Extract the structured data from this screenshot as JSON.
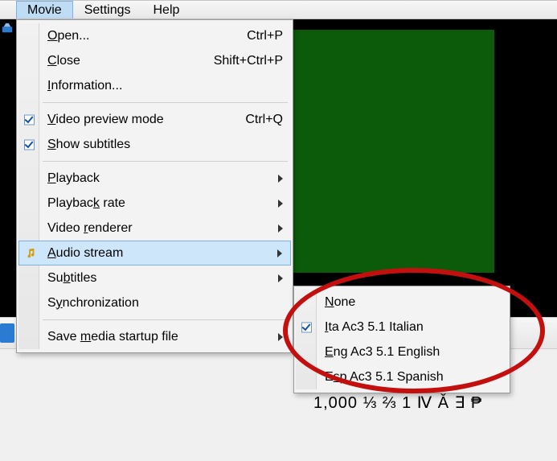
{
  "menubar": {
    "items": [
      {
        "label": "Movie",
        "active": true
      },
      {
        "label": "Settings",
        "active": false
      },
      {
        "label": "Help",
        "active": false
      }
    ]
  },
  "menu": {
    "open": {
      "label_pre": "",
      "u": "O",
      "label_post": "pen...",
      "shortcut": "Ctrl+P"
    },
    "close": {
      "label_pre": "",
      "u": "C",
      "label_post": "lose",
      "shortcut": "Shift+Ctrl+P"
    },
    "info": {
      "label_pre": "",
      "u": "I",
      "label_post": "nformation...",
      "shortcut": ""
    },
    "vpreview": {
      "label_pre": "",
      "u": "V",
      "label_post": "ideo preview mode",
      "shortcut": "Ctrl+Q",
      "checked": true
    },
    "showsub": {
      "label_pre": "",
      "u": "S",
      "label_post": "how subtitles",
      "shortcut": "",
      "checked": true
    },
    "playback": {
      "label_pre": "",
      "u": "P",
      "label_post": "layback"
    },
    "playrate": {
      "label_pre": "Playbac",
      "u": "k",
      "label_post": " rate"
    },
    "vrender": {
      "label_pre": "Video ",
      "u": "r",
      "label_post": "enderer"
    },
    "astream": {
      "label_pre": "",
      "u": "A",
      "label_post": "udio stream"
    },
    "subtitles": {
      "label_pre": "Su",
      "u": "b",
      "label_post": "titles"
    },
    "sync": {
      "label_pre": "S",
      "u": "y",
      "label_post": "nchronization"
    },
    "savestart": {
      "label_pre": "Save ",
      "u": "m",
      "label_post": "edia startup file"
    }
  },
  "submenu": {
    "none": {
      "label_pre": "",
      "u": "N",
      "label_post": "one",
      "checked": false
    },
    "ita": {
      "label_pre": "",
      "u": "I",
      "label_post": "ta Ac3 5.1 Italian",
      "checked": true
    },
    "eng": {
      "label_pre": "",
      "u": "E",
      "label_post": "ng Ac3 5.1 English",
      "checked": false
    },
    "esp": {
      "label_pre": "E",
      "u": "s",
      "label_post": "p Ac3 5.1 Spanish",
      "checked": false
    }
  },
  "below_text": "1,000  ⅓ ⅔ 1 Ⅳ Ǎ ∃ ₱"
}
